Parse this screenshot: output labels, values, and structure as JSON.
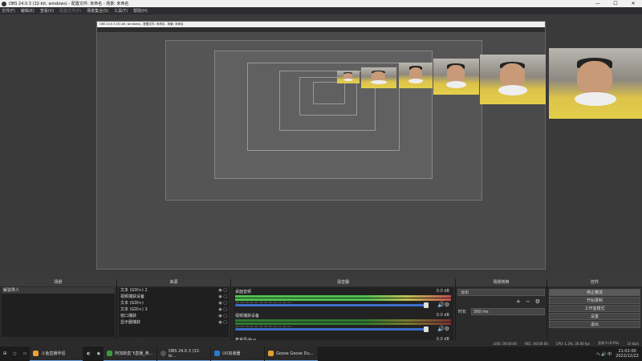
{
  "window": {
    "title": "OBS 24.0.3 (32-bit, windows) - 配置文件: 未命名 - 场景: 未命名",
    "minimize": "—",
    "maximize": "☐",
    "close": "✕"
  },
  "menu": [
    "文件(F)",
    "编辑(E)",
    "查看(V)",
    "配置文件(P)",
    "场景集合(S)",
    "工具(T)",
    "帮助(H)"
  ],
  "nested_title": "OBS 24.0.3 (32-bit, windows) - 配置文件: 未命名 - 场景: 未命名",
  "scenes": {
    "header": "场景",
    "items": [
      "解说男人"
    ]
  },
  "sources": {
    "header": "来源",
    "items": [
      "文本 (GDI+) 2",
      "视频捕获设备",
      "文本 (GDI+)",
      "文本 (GDI+) 3",
      "窗口捕获",
      "显示器捕获"
    ]
  },
  "mixer": {
    "header": "混音器",
    "channels": [
      {
        "name": "桌面音频",
        "db": "0.0 dB"
      },
      {
        "name": "视频捕获设备",
        "db": "0.0 dB"
      },
      {
        "name": "麦克风/Aux",
        "db": "0.0 dB"
      }
    ],
    "scale": "-60 -55 -50 -45 -40 -35 -30 -25 -20 -15 -10 -5 0"
  },
  "transitions": {
    "header": "场景转换",
    "type": "淡出",
    "duration_label": "时长",
    "duration_value": "300 ms"
  },
  "controls": {
    "header": "控件",
    "buttons": [
      "停止推流",
      "开始录制",
      "工作室模式",
      "设置",
      "退出"
    ]
  },
  "footer_icons": {
    "add": "+",
    "remove": "−",
    "settings": "⚙",
    "up": "⌃",
    "down": "⌄"
  },
  "status": {
    "live": "LIVE: 00:00:00",
    "rec": "REC: 00:00:00",
    "cpu": "CPU: 1.3%, 30.00 fps",
    "dropped": "丢帧 0 (0.0%)",
    "bitrate": "10 kb/s"
  },
  "taskbar": {
    "tasks": [
      {
        "label": "斗鱼直播伴侣",
        "color": "#f0a030"
      },
      {
        "label": "阿加斯直飞直播_英...",
        "color": "#3a9a3a"
      },
      {
        "label": "OBS 24.0.3 (32-bi...",
        "color": "#444"
      },
      {
        "label": "UU加速器",
        "color": "#2a7ad0"
      },
      {
        "label": "Goose Goose Du...",
        "color": "#e0a030"
      }
    ],
    "tray": "へ 🔊 中",
    "time": "21:02:00",
    "date": "2022/12/22"
  }
}
